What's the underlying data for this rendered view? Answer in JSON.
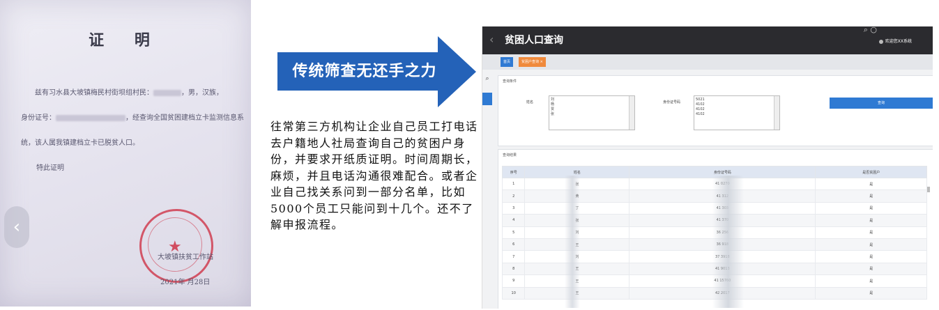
{
  "certificate": {
    "title": "证 明",
    "line1": "兹有习水县大坡镇梅民村街坝组村民：",
    "line1_suffix": "，男，汉族，",
    "line2_prefix": "身份证号：",
    "line2_suffix": "，经查询全国贫困建档立卡监测信息系",
    "line3": "统，该人属我镇建档立卡已脱贫人口。",
    "line4": "特此证明",
    "signer": "大坡镇扶贫工作站",
    "date": "2021年 月28日",
    "prev_icon": "chevron-left-icon"
  },
  "arrow": {
    "text": "传统筛查无还手之力",
    "color": "#2462b8"
  },
  "description": "往常第三方机构让企业自己员工打电话去户籍地人社局查询自己的贫困户身份，并要求开纸质证明。时间周期长，麻烦，并且电话沟通很难配合。或者企业自己找关系问到一部分名单，比如5000个员工只能问到十几个。还不了解申报流程。",
  "app": {
    "title": "贫困人口查询",
    "user": "欢迎您XX系统",
    "tabs": [
      {
        "label": "首页",
        "color": "#2f7ad3"
      },
      {
        "label": "贫困户查询 ×",
        "color": "#f08a3c"
      }
    ],
    "query_panel": {
      "header": "查询条件",
      "name_label": "姓名",
      "id_label": "身份证号码",
      "name_values": [
        "刘",
        "杨",
        "贾",
        "张"
      ],
      "id_values": [
        "5021",
        "4102",
        "4102",
        "4102"
      ],
      "button": "查询"
    },
    "results_panel": {
      "header": "查询结果",
      "columns": [
        "序号",
        "姓名",
        "身份证号码",
        "是否贫困户"
      ],
      "rows": [
        {
          "n": "1",
          "name": "张",
          "id": "41 0270",
          "flag": "是"
        },
        {
          "n": "2",
          "name": "黄",
          "id": "41 312",
          "flag": "是"
        },
        {
          "n": "3",
          "name": "丁",
          "id": "41 303",
          "flag": "是"
        },
        {
          "n": "4",
          "name": "张",
          "id": "41 370",
          "flag": "是"
        },
        {
          "n": "5",
          "name": "刘",
          "id": "36 256",
          "flag": "是"
        },
        {
          "n": "6",
          "name": "王",
          "id": "36 918",
          "flag": "是"
        },
        {
          "n": "7",
          "name": "刘",
          "id": "37 3918",
          "flag": "是"
        },
        {
          "n": "8",
          "name": "王",
          "id": "41 9013",
          "flag": "是"
        },
        {
          "n": "9",
          "name": "王",
          "id": "41 15760",
          "flag": "是"
        },
        {
          "n": "10",
          "name": "王",
          "id": "42 2017",
          "flag": "是"
        }
      ]
    }
  }
}
